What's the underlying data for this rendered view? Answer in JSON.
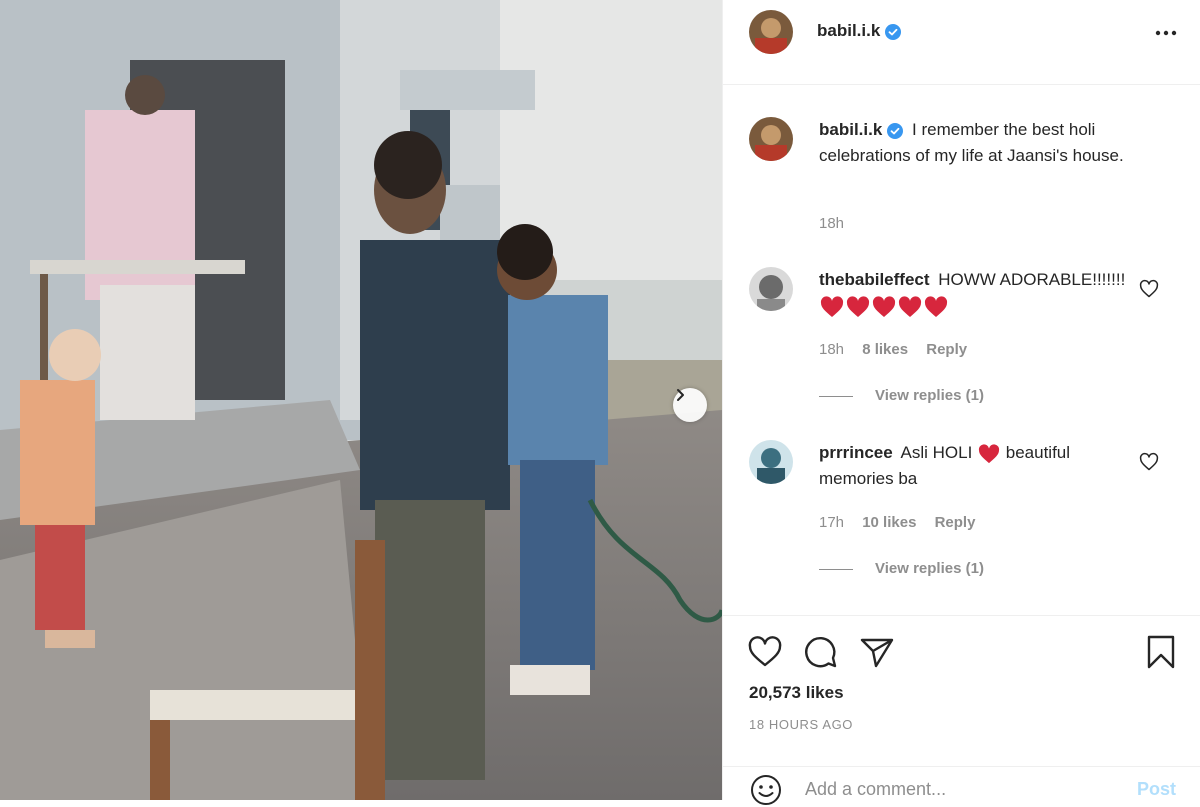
{
  "post": {
    "username": "babil.i.k",
    "verified": true,
    "caption": "I remember the best holi celebrations of my life at Jaansi's house.",
    "caption_time": "18h",
    "likes": "20,573 likes",
    "time_ago": "18 HOURS AGO"
  },
  "comments": [
    {
      "username": "thebabileffect",
      "text": "HOWW ADORABLE!!!!!!!",
      "hearts": 5,
      "time": "18h",
      "likes": "8 likes",
      "reply_label": "Reply",
      "view_replies": "View replies (1)"
    },
    {
      "username": "prrrincee",
      "text_before": "Asli HOLI",
      "text_after": "beautiful memories ba",
      "time": "17h",
      "likes": "10 likes",
      "reply_label": "Reply",
      "view_replies": "View replies (1)"
    }
  ],
  "add_comment": {
    "placeholder": "Add a comment...",
    "post_label": "Post"
  },
  "icons": {
    "verified": "verified-badge-icon",
    "more": "more-options-icon",
    "like": "heart-icon",
    "comment": "comment-icon",
    "share": "share-icon",
    "save": "bookmark-icon",
    "emoji": "emoji-icon",
    "next": "chevron-right-icon"
  },
  "colors": {
    "verified_blue": "#3897f0",
    "heart_red": "#e0245e",
    "post_disabled": "#b2dffc",
    "muted_text": "#8e8e8e"
  }
}
